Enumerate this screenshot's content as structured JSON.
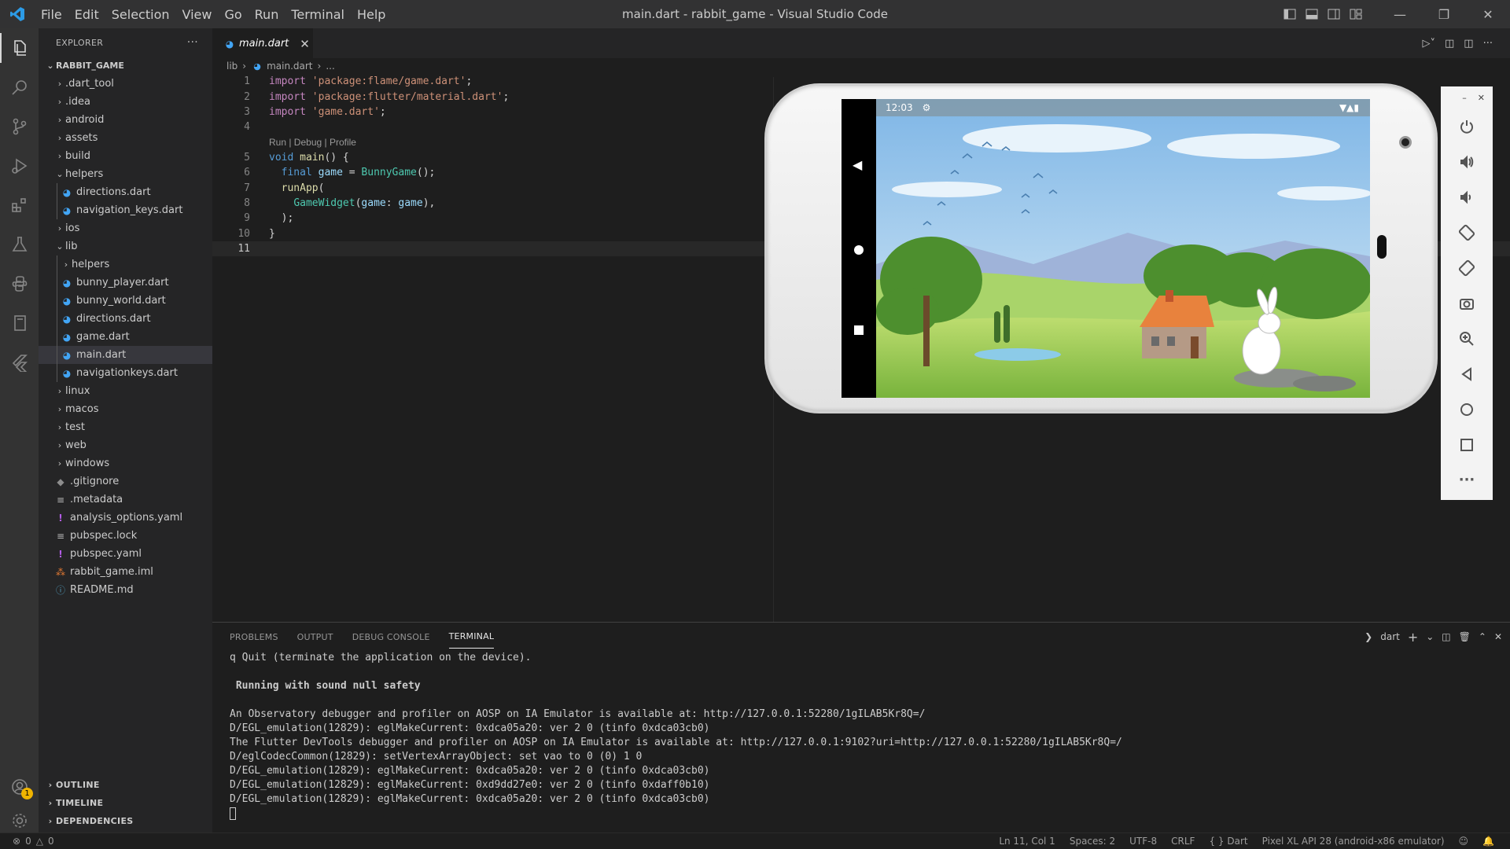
{
  "window": {
    "title": "main.dart - rabbit_game - Visual Studio Code",
    "menu": [
      "File",
      "Edit",
      "Selection",
      "View",
      "Go",
      "Run",
      "Terminal",
      "Help"
    ]
  },
  "sidebar": {
    "header": "EXPLORER",
    "more": "···",
    "root": "RABBIT_GAME",
    "items": [
      {
        "label": ".dart_tool",
        "type": "folder",
        "depth": 1
      },
      {
        "label": ".idea",
        "type": "folder",
        "depth": 1
      },
      {
        "label": "android",
        "type": "folder",
        "depth": 1
      },
      {
        "label": "assets",
        "type": "folder",
        "depth": 1
      },
      {
        "label": "build",
        "type": "folder",
        "depth": 1
      },
      {
        "label": "helpers",
        "type": "folder-open",
        "depth": 1
      },
      {
        "label": "directions.dart",
        "type": "dart",
        "depth": 2
      },
      {
        "label": "navigation_keys.dart",
        "type": "dart",
        "depth": 2
      },
      {
        "label": "ios",
        "type": "folder",
        "depth": 1
      },
      {
        "label": "lib",
        "type": "folder-open",
        "depth": 1
      },
      {
        "label": "helpers",
        "type": "folder",
        "depth": 2
      },
      {
        "label": "bunny_player.dart",
        "type": "dart",
        "depth": 2
      },
      {
        "label": "bunny_world.dart",
        "type": "dart",
        "depth": 2
      },
      {
        "label": "directions.dart",
        "type": "dart",
        "depth": 2
      },
      {
        "label": "game.dart",
        "type": "dart",
        "depth": 2
      },
      {
        "label": "main.dart",
        "type": "dart",
        "depth": 2,
        "selected": true
      },
      {
        "label": "navigationkeys.dart",
        "type": "dart",
        "depth": 2
      },
      {
        "label": "linux",
        "type": "folder",
        "depth": 1
      },
      {
        "label": "macos",
        "type": "folder",
        "depth": 1
      },
      {
        "label": "test",
        "type": "folder",
        "depth": 1
      },
      {
        "label": "web",
        "type": "folder",
        "depth": 1
      },
      {
        "label": "windows",
        "type": "folder",
        "depth": 1
      },
      {
        "label": ".gitignore",
        "type": "git",
        "depth": 1
      },
      {
        "label": ".metadata",
        "type": "lines",
        "depth": 1
      },
      {
        "label": "analysis_options.yaml",
        "type": "yaml",
        "depth": 1
      },
      {
        "label": "pubspec.lock",
        "type": "lines",
        "depth": 1
      },
      {
        "label": "pubspec.yaml",
        "type": "yaml",
        "depth": 1
      },
      {
        "label": "rabbit_game.iml",
        "type": "rss",
        "depth": 1
      },
      {
        "label": "README.md",
        "type": "info",
        "depth": 1
      }
    ],
    "sections": [
      "OUTLINE",
      "TIMELINE",
      "DEPENDENCIES"
    ]
  },
  "editor": {
    "tab": {
      "label": "main.dart",
      "close": "✕"
    },
    "breadcrumb": [
      "lib",
      "main.dart",
      "..."
    ],
    "codelens": "Run | Debug | Profile",
    "lines": [
      {
        "n": "1",
        "text": "import 'package:flame/game.dart';"
      },
      {
        "n": "2",
        "text": "import 'package:flutter/material.dart';"
      },
      {
        "n": "3",
        "text": "import 'game.dart';"
      },
      {
        "n": "4",
        "text": ""
      },
      {
        "n": "5",
        "text": "void main() {"
      },
      {
        "n": "6",
        "text": "  final game = BunnyGame();"
      },
      {
        "n": "7",
        "text": "  runApp("
      },
      {
        "n": "8",
        "text": "    GameWidget(game: game),"
      },
      {
        "n": "9",
        "text": "  );"
      },
      {
        "n": "10",
        "text": "}"
      },
      {
        "n": "11",
        "text": ""
      }
    ]
  },
  "emulator": {
    "status_time": "12:03",
    "controls": [
      "power-icon",
      "volume-up-icon",
      "volume-down-icon",
      "rotate-left-icon",
      "rotate-right-icon",
      "camera-icon",
      "zoom-icon",
      "back-icon",
      "home-icon",
      "overview-icon",
      "more-icon"
    ],
    "window_min": "–",
    "window_close": "✕"
  },
  "panel": {
    "tabs": [
      "PROBLEMS",
      "OUTPUT",
      "DEBUG CONSOLE",
      "TERMINAL"
    ],
    "active_tab": "TERMINAL",
    "terminal_name": "dart",
    "terminal_lines": [
      {
        "text": "q Quit (terminate the application on the device).",
        "style": "normal"
      },
      {
        "text": "",
        "style": "normal"
      },
      {
        "text": " Running with sound null safety",
        "style": "bold"
      },
      {
        "text": "",
        "style": "normal"
      },
      {
        "text": "An Observatory debugger and profiler on AOSP on IA Emulator is available at: http://127.0.0.1:52280/1gILAB5Kr8Q=/",
        "style": "normal"
      },
      {
        "text": "D/EGL_emulation(12829): eglMakeCurrent: 0xdca05a20: ver 2 0 (tinfo 0xdca03cb0)",
        "style": "normal"
      },
      {
        "text": "The Flutter DevTools debugger and profiler on AOSP on IA Emulator is available at: http://127.0.0.1:9102?uri=http://127.0.0.1:52280/1gILAB5Kr8Q=/",
        "style": "normal"
      },
      {
        "text": "D/eglCodecCommon(12829): setVertexArrayObject: set vao to 0 (0) 1 0",
        "style": "normal"
      },
      {
        "text": "D/EGL_emulation(12829): eglMakeCurrent: 0xdca05a20: ver 2 0 (tinfo 0xdca03cb0)",
        "style": "normal"
      },
      {
        "text": "D/EGL_emulation(12829): eglMakeCurrent: 0xd9dd27e0: ver 2 0 (tinfo 0xdaff0b10)",
        "style": "normal"
      },
      {
        "text": "D/EGL_emulation(12829): eglMakeCurrent: 0xdca05a20: ver 2 0 (tinfo 0xdca03cb0)",
        "style": "normal"
      }
    ]
  },
  "statusbar": {
    "errors": "0",
    "warnings": "0",
    "position": "Ln 11, Col 1",
    "spaces": "Spaces: 2",
    "encoding": "UTF-8",
    "eol": "CRLF",
    "language": "Dart",
    "device": "Pixel XL API 28 (android-x86 emulator)"
  },
  "accounts_badge": "1"
}
